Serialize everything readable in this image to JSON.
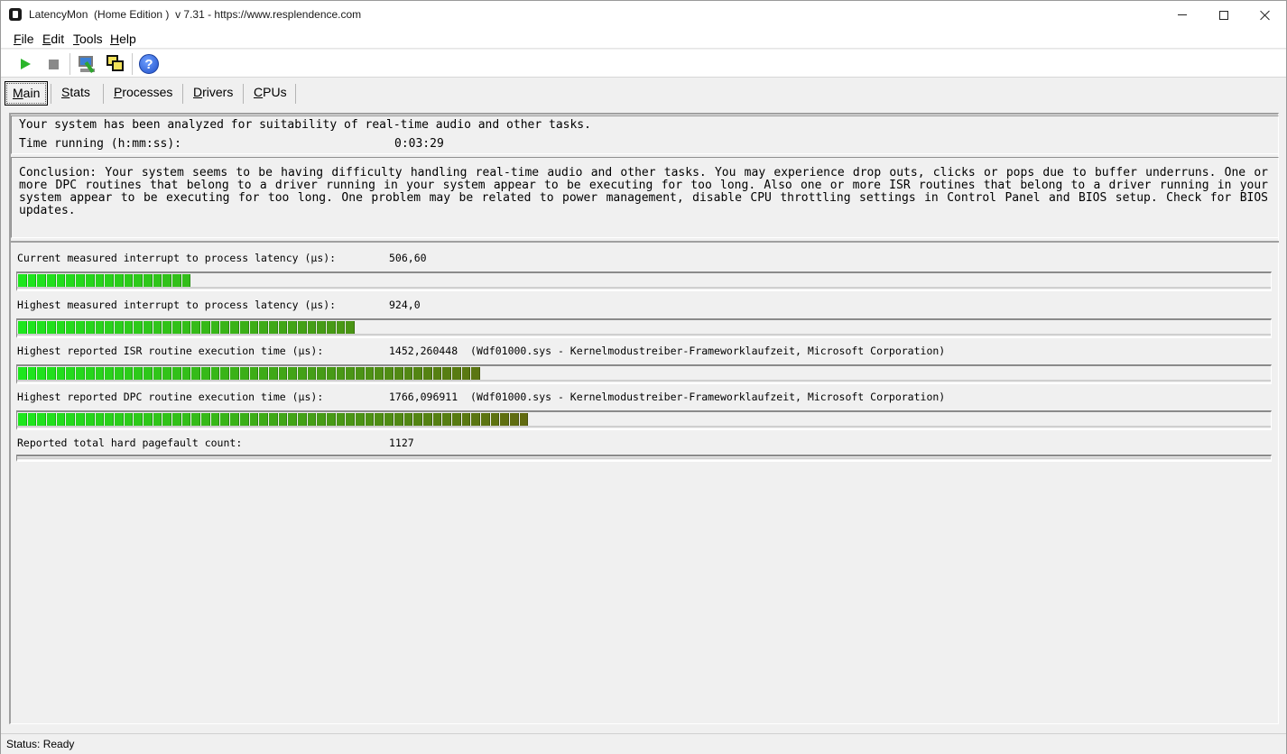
{
  "window": {
    "title": "LatencyMon  (Home Edition )  v 7.31 - https://www.resplendence.com"
  },
  "menu": [
    {
      "label": "File",
      "mnemonic": "F",
      "rest": "ile"
    },
    {
      "label": "Edit",
      "mnemonic": "E",
      "rest": "dit"
    },
    {
      "label": "Tools",
      "mnemonic": "T",
      "rest": "ools"
    },
    {
      "label": "Help",
      "mnemonic": "H",
      "rest": "elp"
    }
  ],
  "toolbar": {
    "icons": [
      "play-icon",
      "stop-icon",
      "computer-tools-icon",
      "windows-icon",
      "help-icon"
    ],
    "help_glyph": "?"
  },
  "tabs": [
    {
      "label": "Main",
      "mnemonic": "M",
      "rest": "ain",
      "active": true
    },
    {
      "label": "Stats",
      "mnemonic": "S",
      "rest": "tats",
      "active": false
    },
    {
      "label": "Processes",
      "mnemonic": "P",
      "rest": "rocesses",
      "active": false
    },
    {
      "label": "Drivers",
      "mnemonic": "D",
      "rest": "rivers",
      "active": false
    },
    {
      "label": "CPUs",
      "mnemonic": "C",
      "rest": "PUs",
      "active": false
    }
  ],
  "info": {
    "analyzed_text": "Your system has been analyzed for suitability of real-time audio and other tasks.",
    "time_label": "Time running (h:mm:ss):",
    "time_value": "0:03:29"
  },
  "conclusion": "Conclusion: Your system seems to be having difficulty handling real-time audio and other tasks. You may experience drop outs, clicks or pops due to buffer underruns. One or more DPC routines that belong to a driver running in your system appear to be executing for too long. Also one or more ISR routines that belong to a driver running in your system appear to be executing for too long. One problem may be related to power management, disable CPU throttling settings in Control Panel and BIOS setup. Check for BIOS updates.",
  "metrics": [
    {
      "label": "Current measured interrupt to process latency (µs):",
      "value": "506,60",
      "detail": "",
      "segments": 18
    },
    {
      "label": "Highest measured interrupt to process latency (µs):",
      "value": "924,0",
      "detail": "",
      "segments": 35
    },
    {
      "label": "Highest reported ISR routine execution time (µs):",
      "value": "1452,260448",
      "detail": "(Wdf01000.sys - Kernelmodustreiber-Frameworklaufzeit, Microsoft Corporation)",
      "segments": 48
    },
    {
      "label": "Highest reported DPC routine execution time (µs):",
      "value": "1766,096911",
      "detail": "(Wdf01000.sys - Kernelmodustreiber-Frameworklaufzeit, Microsoft Corporation)",
      "segments": 53
    },
    {
      "label": "Reported total hard pagefault count:",
      "value": "1127",
      "detail": "",
      "segments": 0
    }
  ],
  "bar_colors": {
    "start": "#1de61d",
    "end": "#6b5a0f"
  },
  "status": {
    "text": "Status: Ready"
  }
}
